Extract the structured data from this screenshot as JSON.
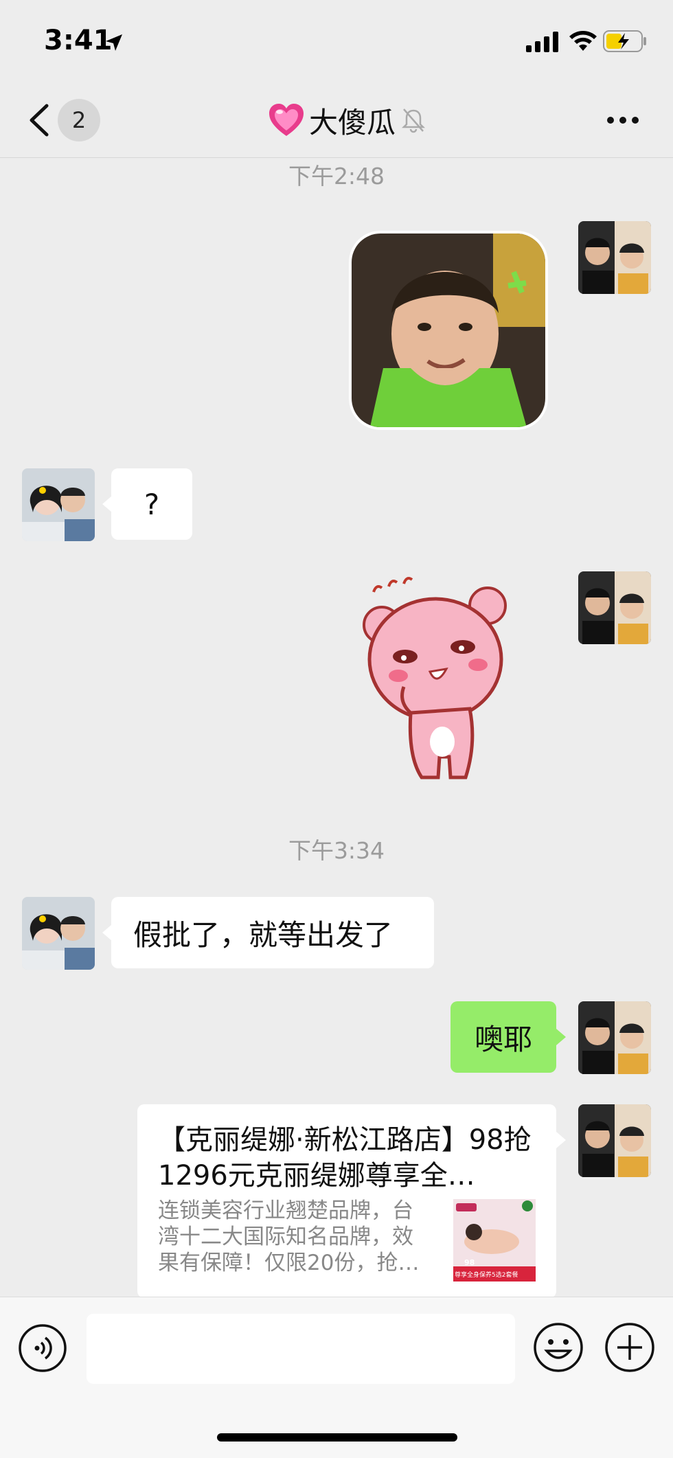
{
  "status_bar": {
    "time": "3:41"
  },
  "nav": {
    "unread_count": "2",
    "title": "大傻瓜"
  },
  "messages": {
    "timestamp_1": "下午2:48",
    "question_text": "?",
    "timestamp_2": "下午3:34",
    "incoming_text": "假批了，就等出发了",
    "outgoing_text": "噢耶"
  },
  "link_card": {
    "title": "【克丽缇娜·新松江路店】98抢1296元克丽缇娜尊享全…",
    "description": "连锁美容行业翘楚品牌，台湾十二大国际知名品牌，效果有保障！仅限20份，抢…",
    "thumb_caption": "98",
    "thumb_banner": "尊享全身保养5选2套餐"
  },
  "icons": [
    "location-arrow-icon",
    "signal-icon",
    "wifi-icon",
    "battery-charging-icon",
    "back-chevron-icon",
    "heart-icon",
    "mute-bell-icon",
    "more-icon",
    "voice-icon",
    "emoji-icon",
    "plus-icon"
  ],
  "colors": {
    "outgoing_bubble": "#95ec69",
    "background": "#ededed"
  }
}
